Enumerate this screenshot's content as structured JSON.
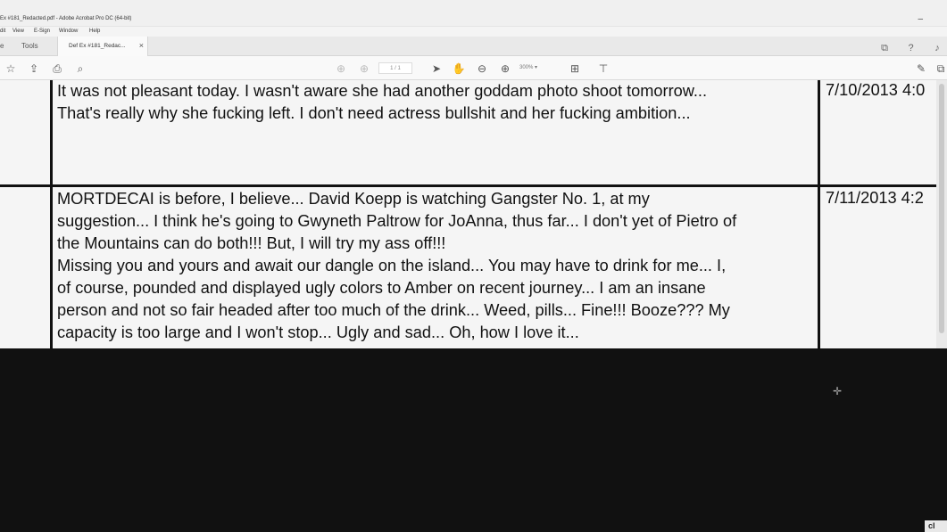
{
  "window": {
    "title": "Ex #181_Redacted.pdf - Adobe Acrobat Pro DC (64-bit)",
    "minimize_glyph": "–"
  },
  "menu": [
    "dit",
    "View",
    "E-Sign",
    "Window",
    "Help"
  ],
  "tabs": {
    "home": "e",
    "tools": "Tools",
    "document": "Def Ex  #181_Redac...",
    "close_glyph": "×"
  },
  "toolbar": {
    "page_indicator": "1  /  1",
    "zoom": "300%",
    "icons": [
      "star-icon",
      "upload-icon",
      "print-icon",
      "search-icon",
      "page-up-icon",
      "page-down-icon",
      "select-arrow-icon",
      "hand-icon",
      "zoom-out-icon",
      "zoom-in-icon",
      "fit-page-icon",
      "scroll-mode-icon",
      "sign-icon",
      "share-icon"
    ]
  },
  "rows": [
    {
      "message": "It was not pleasant today. I wasn't aware she had another goddam photo shoot tomorrow...\nThat's really why she fucking left. I don't need actress bullshit and her fucking ambition...",
      "date": "7/10/2013 4:0"
    },
    {
      "message": "MORTDECAI is before, I believe... David Koepp is watching Gangster No. 1, at my\nsuggestion... I think he's going to Gwyneth Paltrow for JoAnna, thus far... I don't yet of Pietro of\nthe Mountains can do both!!! But, I will try my ass off!!!\nMissing you and yours and await our dangle on the island... You may have to drink for me... I,\nof course, pounded and displayed ugly colors to Amber on recent journey... I am an insane\nperson and not so fair headed after too much of the drink... Weed, pills... Fine!!! Booze??? My\ncapacity is too large and I won't stop... Ugly and sad... Oh, how I love it...",
      "date": "7/11/2013 4:2"
    }
  ],
  "overlay": {
    "corner_badge": "cl"
  }
}
